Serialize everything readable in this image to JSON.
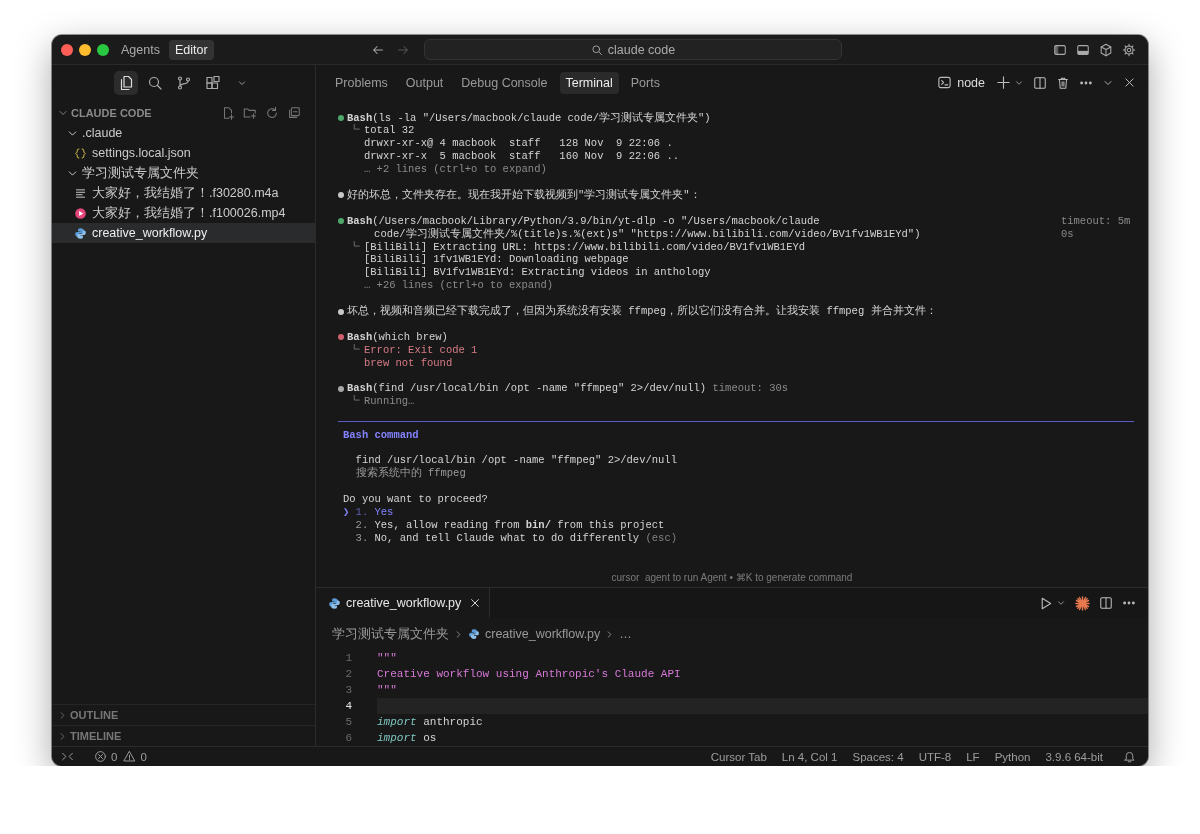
{
  "window": {
    "mode_tabs": [
      {
        "label": "Agents",
        "selected": false
      },
      {
        "label": "Editor",
        "selected": true
      }
    ],
    "search": "claude code"
  },
  "sidebar": {
    "activity_bar": [
      {
        "kind": "files",
        "selected": true
      },
      {
        "kind": "search",
        "selected": false
      },
      {
        "kind": "source-control",
        "selected": false
      },
      {
        "kind": "extensions",
        "selected": false
      },
      {
        "kind": "more",
        "selected": false
      }
    ],
    "section": {
      "title": "CLAUDE CODE",
      "expanded": true
    },
    "tree": [
      {
        "label": ".claude",
        "kind": "folder",
        "expanded": true,
        "selected": false,
        "children": [
          {
            "label": "settings.local.json",
            "kind": "json",
            "selected": false
          }
        ]
      },
      {
        "label": "学习测试专属文件夹",
        "kind": "folder",
        "expanded": true,
        "selected": false,
        "children": [
          {
            "label": "大家好，我结婚了！.f30280.m4a",
            "kind": "audio",
            "selected": false
          },
          {
            "label": "大家好，我结婚了！.f100026.mp4",
            "kind": "video",
            "selected": false
          },
          {
            "label": "creative_workflow.py",
            "kind": "python",
            "selected": true
          }
        ]
      }
    ],
    "footer_sections": [
      {
        "title": "OUTLINE",
        "expanded": false
      },
      {
        "title": "TIMELINE",
        "expanded": false
      }
    ]
  },
  "panel": {
    "tabs": [
      {
        "label": "Problems",
        "selected": false
      },
      {
        "label": "Output",
        "selected": false
      },
      {
        "label": "Debug Console",
        "selected": false
      },
      {
        "label": "Terminal",
        "selected": true
      },
      {
        "label": "Ports",
        "selected": false
      }
    ],
    "terminal_name": "node",
    "entries": [
      {
        "kind": "tool",
        "color": "#4ea86a",
        "command": [
          "**Bash**(ls -la \"/Users/macbook/claude code/学习测试专属文件夹\")"
        ],
        "output": [
          {
            "kind": "normal",
            "text": "total 32"
          },
          {
            "kind": "normal",
            "text": "drwxr-xr-x@ 4 macbook  staff   128 Nov  9 22:06 ."
          },
          {
            "kind": "normal",
            "text": "drwxr-xr-x  5 macbook  staff   160 Nov  9 22:06 .."
          },
          {
            "kind": "more",
            "text": "… +2 lines (ctrl+o to expand)"
          }
        ]
      },
      {
        "kind": "message",
        "color": "#c8c8c8",
        "text": "好的坏总，文件夹存在。现在我开始下载视频到\"学习测试专属文件夹\"："
      },
      {
        "kind": "tool",
        "color": "#4ea86a",
        "command": [
          "**Bash**(/Users/macbook/Library/Python/3.9/bin/yt-dlp -o \"/Users/macbook/claude",
          "code/学习测试专属文件夹/%(title)s.%(ext)s\" \"https://www.bilibili.com/video/BV1fv1WB1EYd\")"
        ],
        "timeout": "timeout: 5m 0s",
        "output": [
          {
            "kind": "normal",
            "text": "[BiliBili] Extracting URL: https://www.bilibili.com/video/BV1fv1WB1EYd"
          },
          {
            "kind": "normal",
            "text": "[BiliBili] 1fv1WB1EYd: Downloading webpage"
          },
          {
            "kind": "normal",
            "text": "[BiliBili] BV1fv1WB1EYd: Extracting videos in anthology"
          },
          {
            "kind": "more",
            "text": "… +26 lines (ctrl+o to expand)"
          }
        ]
      },
      {
        "kind": "message",
        "color": "#c8c8c8",
        "text": "坏总，视频和音频已经下载完成了，但因为系统没有安装 ffmpeg，所以它们没有合并。让我安装 ffmpeg 并合并文件："
      },
      {
        "kind": "tool",
        "color": "#d0606e",
        "command": [
          "**Bash**(which brew)"
        ],
        "output": [
          {
            "kind": "error",
            "text": "Error: Exit code 1"
          },
          {
            "kind": "error",
            "text": "brew not found"
          }
        ]
      },
      {
        "kind": "tool",
        "color": "#a8a8a8",
        "command": [
          "**Bash**(find /usr/local/bin /opt -name \"ffmpeg\" 2>/dev/null)"
        ],
        "timeout": "timeout: 30s",
        "output": [
          {
            "kind": "more",
            "text": "Running…"
          }
        ]
      }
    ],
    "prompt": {
      "title": "Bash command",
      "command": "find /usr/local/bin /opt -name \"ffmpeg\" 2>/dev/null",
      "description": "搜索系统中的 ffmpeg",
      "question": "Do you want to proceed?",
      "pointer": "❯",
      "options": [
        {
          "number": "1.",
          "label": "Yes",
          "selected": true
        },
        {
          "number": "2.",
          "label": "Yes, allow reading from **bin/** from this project",
          "selected": false
        },
        {
          "number": "3.",
          "label": "No, and tell Claude what to do differently",
          "hint": "(esc)",
          "selected": false
        }
      ]
    },
    "hint": "cursor  agent to run Agent • ⌘K to generate command"
  },
  "editor": {
    "tab": {
      "label": "creative_workflow.py",
      "selected": true
    },
    "breadcrumbs": [
      {
        "label": "学习测试专属文件夹",
        "kind": "folder"
      },
      {
        "label": "creative_workflow.py",
        "kind": "python"
      },
      {
        "label": "…",
        "kind": "more"
      }
    ],
    "lines": [
      {
        "number": "1",
        "current": false,
        "tokens": [
          {
            "kind": "string",
            "text": "\"\"\""
          }
        ]
      },
      {
        "number": "2",
        "current": false,
        "tokens": [
          {
            "kind": "string",
            "text": "Creative workflow using Anthropic's Claude API"
          }
        ]
      },
      {
        "number": "3",
        "current": false,
        "tokens": [
          {
            "kind": "string",
            "text": "\"\"\""
          }
        ]
      },
      {
        "number": "4",
        "current": true
      },
      {
        "number": "5",
        "current": false,
        "tokens": [
          {
            "kind": "keyword",
            "text": "import"
          },
          {
            "kind": "plain",
            "text": " anthropic"
          }
        ]
      },
      {
        "number": "6",
        "current": false,
        "tokens": [
          {
            "kind": "keyword",
            "text": "import"
          },
          {
            "kind": "plain",
            "text": " os"
          }
        ]
      }
    ]
  },
  "status_bar": {
    "errors": "0",
    "warnings": "0",
    "items": [
      "Cursor Tab",
      "Ln 4, Col 1",
      "Spaces: 4",
      "UTF-8",
      "LF",
      "Python",
      "3.9.6 64-bit"
    ]
  }
}
